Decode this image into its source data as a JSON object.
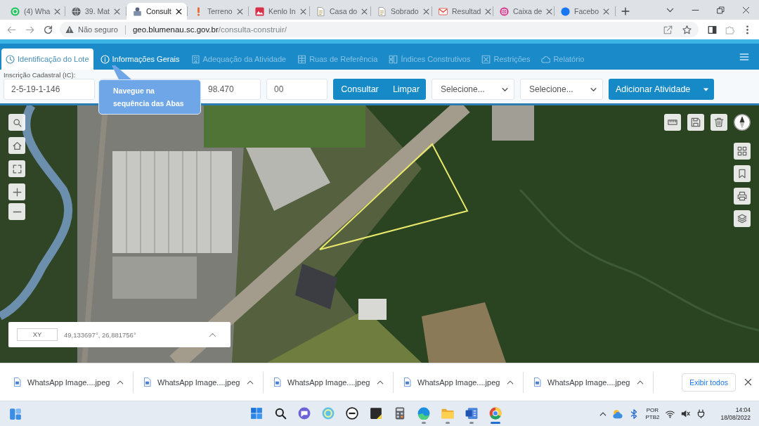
{
  "browser": {
    "tabs": [
      {
        "title": "(4) Wha",
        "selected": false
      },
      {
        "title": "39. Mat",
        "selected": false
      },
      {
        "title": "Consult",
        "selected": true
      },
      {
        "title": "Terreno",
        "selected": false
      },
      {
        "title": "Kenlo In",
        "selected": false
      },
      {
        "title": "Casa do",
        "selected": false
      },
      {
        "title": "Sobrado",
        "selected": false
      },
      {
        "title": "Resultad",
        "selected": false
      },
      {
        "title": "Caixa de",
        "selected": false
      },
      {
        "title": "Facebo",
        "selected": false
      }
    ],
    "address_bar": {
      "security": "Não seguro",
      "domain": "geo.blumenau.sc.gov.br",
      "path": "/consulta-construir/"
    }
  },
  "app": {
    "nav_tabs": [
      {
        "label": "Identificação do Lote",
        "selected": true,
        "disabled": false
      },
      {
        "label": "Informações Gerais",
        "selected": false,
        "disabled": false
      },
      {
        "label": "Adequação da Atividade",
        "selected": false,
        "disabled": true
      },
      {
        "label": "Ruas de Referência",
        "selected": false,
        "disabled": true
      },
      {
        "label": "Índices Construtivos",
        "selected": false,
        "disabled": true
      },
      {
        "label": "Restrições",
        "selected": false,
        "disabled": true
      },
      {
        "label": "Relatório",
        "selected": false,
        "disabled": true
      }
    ],
    "form": {
      "label": "Inscrição Cadastral (IC):",
      "fields": [
        {
          "value": "2-5-19-1-146"
        },
        {
          "value": "98.470"
        },
        {
          "value": "00"
        }
      ],
      "actions": [
        "Consultar",
        "Limpar"
      ],
      "selects": [
        {
          "value": "Selecione..."
        },
        {
          "value": "Selecione..."
        }
      ],
      "add_button": "Adicionar Atividade"
    },
    "tooltip": "Navegue na sequência das Abas",
    "map": {
      "coordinate_label": "XY",
      "coordinates": "49,133697°, 26,881756°"
    }
  },
  "downloads": {
    "items": [
      {
        "name": "WhatsApp Image....jpeg"
      },
      {
        "name": "WhatsApp Image....jpeg"
      },
      {
        "name": "WhatsApp Image....jpeg"
      },
      {
        "name": "WhatsApp Image....jpeg"
      },
      {
        "name": "WhatsApp Image....jpeg"
      }
    ],
    "show_all": "Exibir todos"
  },
  "taskbar": {
    "apps": [
      {
        "kind": "start",
        "running": false,
        "selected": false
      },
      {
        "kind": "search",
        "running": false,
        "selected": false
      },
      {
        "kind": "chat",
        "running": false,
        "selected": false
      },
      {
        "kind": "globe",
        "running": false,
        "selected": false
      },
      {
        "kind": "logo",
        "running": false,
        "selected": false
      },
      {
        "kind": "notes",
        "running": false,
        "selected": false
      },
      {
        "kind": "calculator",
        "running": false,
        "selected": false
      },
      {
        "kind": "wave",
        "running": true,
        "selected": false
      },
      {
        "kind": "folder",
        "running": true,
        "selected": false
      },
      {
        "kind": "document",
        "running": true,
        "selected": false
      },
      {
        "kind": "ring",
        "running": true,
        "selected": true
      }
    ],
    "tray": {
      "language": "POR",
      "layout": "PTB2",
      "time": "14:04",
      "date": "18/08/2022"
    }
  }
}
